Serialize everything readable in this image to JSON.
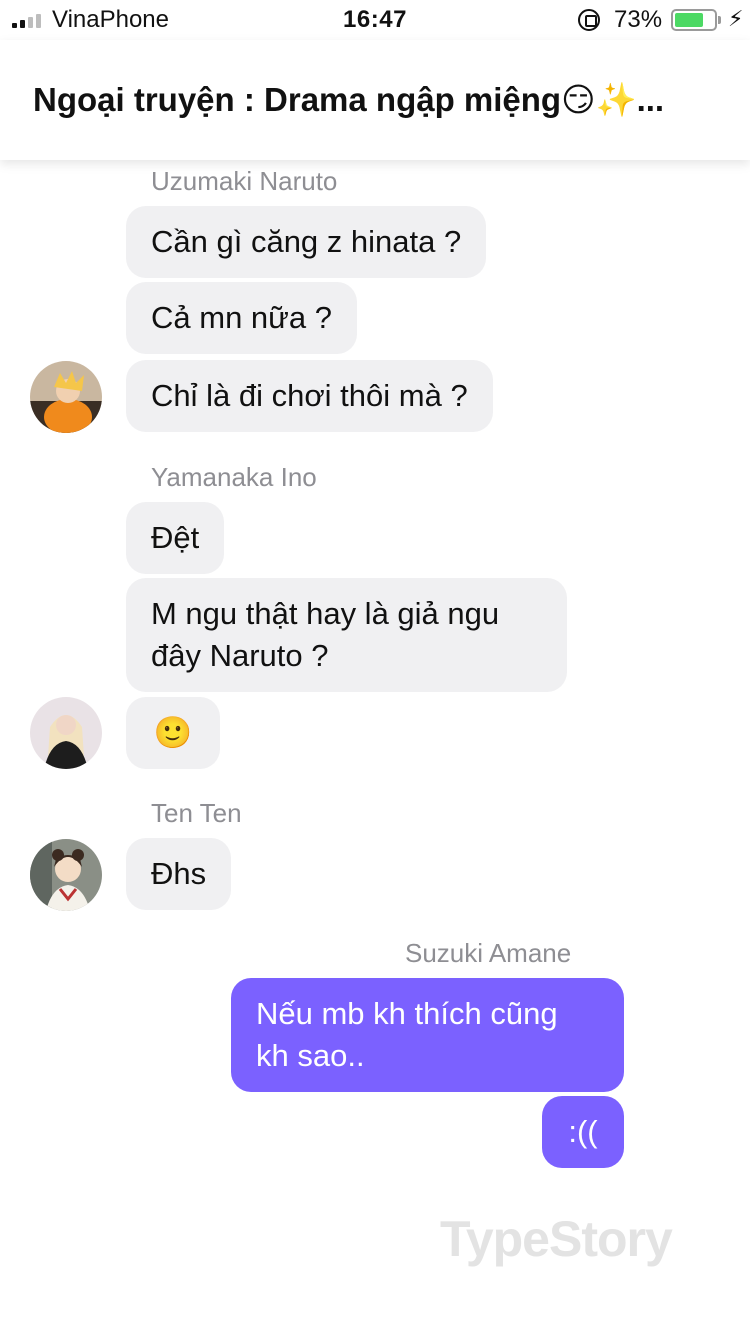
{
  "status_bar": {
    "carrier": "VinaPhone",
    "time": "16:47",
    "battery_percent": "73%",
    "battery_level": 0.73,
    "charging_symbol": "⚡"
  },
  "header": {
    "title": "Ngoại truyện : Drama ngập miệng😏✨..."
  },
  "messages": [
    {
      "sender": "Uzumaki Naruto",
      "direction": "incoming",
      "avatar": "naruto-avatar",
      "bubbles": [
        "Cần gì căng z hinata ?",
        "Cả mn nữa ?",
        "Chỉ là đi chơi thôi mà ?"
      ]
    },
    {
      "sender": "Yamanaka Ino",
      "direction": "incoming",
      "avatar": "ino-avatar",
      "bubbles": [
        "Đệt",
        "M ngu thật hay là giả ngu",
        "đây Naruto ?",
        "🙂"
      ]
    },
    {
      "sender": "Ten Ten",
      "direction": "incoming",
      "avatar": "tenten-avatar",
      "bubbles": [
        "Đhs"
      ]
    },
    {
      "sender": "Suzuki Amane",
      "direction": "outgoing",
      "bubbles": [
        "Nếu mb kh thích cũng",
        "kh sao..",
        ":(("
      ]
    }
  ],
  "watermark": "TypeStory",
  "colors": {
    "incoming_bubble": "#f0f0f2",
    "outgoing_bubble": "#7b61ff",
    "sender_name": "#8e8e93",
    "battery": "#4cd964"
  }
}
